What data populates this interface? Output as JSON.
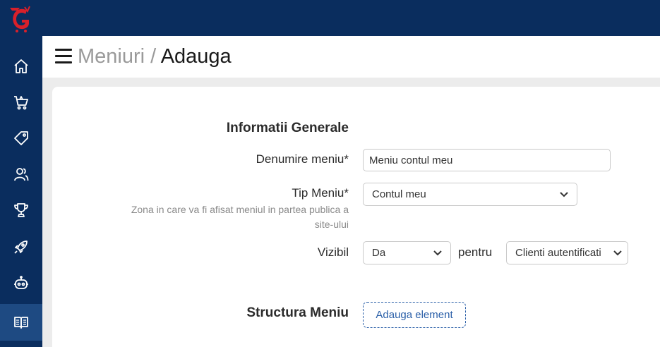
{
  "header": {
    "breadcrumb_parent": "Meniuri",
    "separator": "/",
    "current": "Adauga"
  },
  "sidebar": {
    "items": [
      {
        "icon": "home-icon"
      },
      {
        "icon": "cart-icon"
      },
      {
        "icon": "tag-icon"
      },
      {
        "icon": "users-icon"
      },
      {
        "icon": "trophy-icon"
      },
      {
        "icon": "rocket-icon"
      },
      {
        "icon": "robot-icon"
      },
      {
        "icon": "book-icon",
        "active": true
      }
    ]
  },
  "colors": {
    "navy": "#0a2d5e",
    "active": "#1e4a82",
    "logo_red": "#d9202a",
    "accent": "#2a5fa8"
  },
  "form": {
    "general_title": "Informatii Generale",
    "name_label": "Denumire meniu*",
    "name_value": "Meniu contul meu",
    "type_label": "Tip Meniu*",
    "type_value": "Contul meu",
    "type_hint_line1": "Zona in care va fi afisat meniul in partea publica a",
    "type_hint_line2": "site-ului",
    "visible_label": "Vizibil",
    "visible_value": "Da",
    "for_label": "pentru",
    "audience_value": "Clienti autentificati"
  },
  "structure": {
    "title": "Structura Meniu",
    "add_button": "Adauga element"
  }
}
